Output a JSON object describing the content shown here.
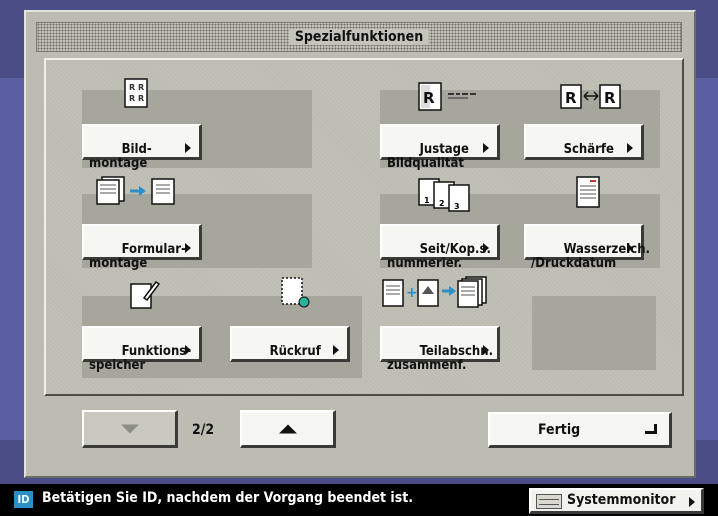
{
  "title": "Spezialfunktionen",
  "functions": [
    {
      "label": "Bild-\nmontage",
      "icon": "image-combination-icon"
    },
    {
      "label": "Justage\nBildqualität",
      "icon": "image-quality-adjust-icon"
    },
    {
      "label": "Schärfe",
      "icon": "sharpness-icon"
    },
    {
      "label": "Formular-\nmontage",
      "icon": "form-composition-icon"
    },
    {
      "label": "Seit/Kop.s.\nnummerier.",
      "icon": "page-numbering-icon"
    },
    {
      "label": "Wasserzeich.\n/Druckdatum",
      "icon": "watermark-icon"
    },
    {
      "label": "Funktions-\nspeicher",
      "icon": "mode-memory-icon"
    },
    {
      "label": "Rückruf",
      "icon": "recall-icon"
    },
    {
      "label": "Teilabschn.\nzusammenf.",
      "icon": "job-build-icon"
    }
  ],
  "pagination": {
    "indicator": "2/2",
    "prev_enabled": false,
    "next_enabled": true
  },
  "done_button": {
    "label": "Fertig"
  },
  "status": {
    "id_badge": "ID",
    "message": "Betätigen Sie ID, nachdem der Vorgang beendet ist.",
    "system_monitor_label": "Systemmonitor"
  },
  "colors": {
    "panel": "#bcbcb2",
    "background_blue": "#5a5fa2",
    "id_badge": "#2b8fc8"
  }
}
